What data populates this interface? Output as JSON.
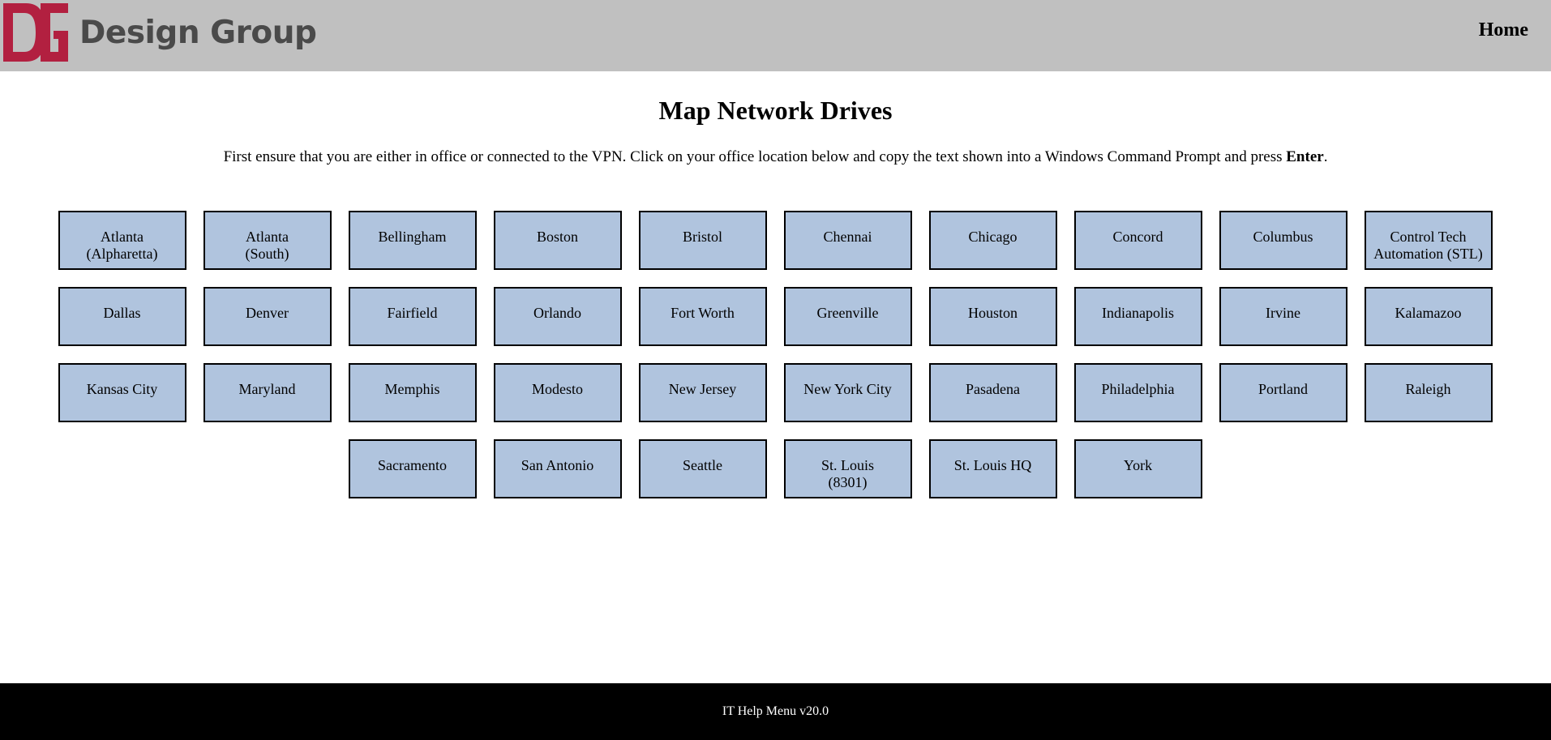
{
  "header": {
    "logo_text": "Design Group",
    "logo_monogram": "DG",
    "home_label": "Home",
    "brand_color": "#b22040"
  },
  "main": {
    "title": "Map Network Drives",
    "instructions_prefix": "First ensure that you are either in office or connected to the VPN. Click on your office location below and copy the text shown into a Windows Command Prompt and press ",
    "instructions_bold": "Enter",
    "instructions_suffix": "."
  },
  "locations": [
    [
      "Atlanta\n(Alpharetta)",
      "Atlanta\n(South)",
      "Bellingham",
      "Boston",
      "Bristol",
      "Chennai",
      "Chicago",
      "Concord",
      "Columbus",
      "Control Tech\nAutomation (STL)"
    ],
    [
      "Dallas",
      "Denver",
      "Fairfield",
      "Orlando",
      "Fort Worth",
      "Greenville",
      "Houston",
      "Indianapolis",
      "Irvine",
      "Kalamazoo"
    ],
    [
      "Kansas City",
      "Maryland",
      "Memphis",
      "Modesto",
      "New Jersey",
      "New York City",
      "Pasadena",
      "Philadelphia",
      "Portland",
      "Raleigh"
    ],
    [
      "Sacramento",
      "San Antonio",
      "Seattle",
      "St. Louis\n(8301)",
      "St. Louis HQ",
      "York"
    ]
  ],
  "footer": {
    "text": "IT Help Menu v20.0"
  }
}
